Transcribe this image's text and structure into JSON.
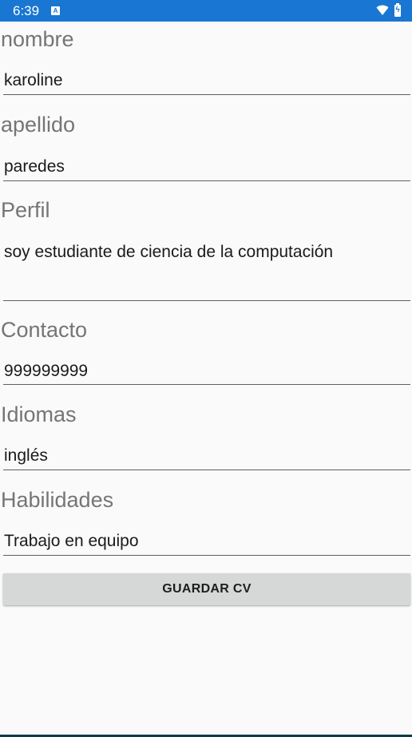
{
  "status_bar": {
    "time": "6:39",
    "notification_icon": "A",
    "battery_icon": "battery-charging-icon",
    "wifi_icon": "wifi-icon",
    "color": "#1976d2"
  },
  "form": {
    "fields": [
      {
        "label": "nombre",
        "value": "karoline"
      },
      {
        "label": "apellido",
        "value": "paredes"
      },
      {
        "label": "Perfil",
        "value": "soy estudiante de ciencia de la computación"
      },
      {
        "label": "Contacto",
        "value": "999999999"
      },
      {
        "label": "Idiomas",
        "value": "inglés"
      },
      {
        "label": "Habilidades",
        "value": "Trabajo en equipo"
      }
    ],
    "submit_label": "GUARDAR CV"
  }
}
